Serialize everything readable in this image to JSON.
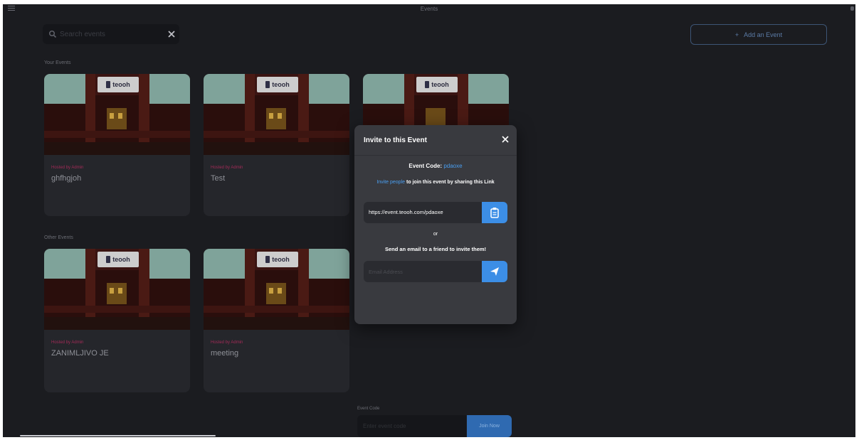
{
  "header": {
    "title": "Events"
  },
  "search": {
    "placeholder": "Search events"
  },
  "add_event": {
    "label": "Add an Event",
    "icon": "plus-icon"
  },
  "sections": {
    "your_events": "Your Events",
    "other_events": "Other Events"
  },
  "logo_text": "teooh",
  "your_events": [
    {
      "host": "Hosted by Admin",
      "title": "ghfhgjoh"
    },
    {
      "host": "Hosted by Admin",
      "title": "Test"
    },
    {
      "host": "",
      "title": ""
    }
  ],
  "other_events": [
    {
      "host": "Hosted by Admin",
      "title": "ZANIMLJIVO JE"
    },
    {
      "host": "Hosted by Admin",
      "title": "meeting"
    }
  ],
  "invite_modal": {
    "title": "Invite to this Event",
    "event_code_label": "Event Code:",
    "event_code": "pdaoxe",
    "invite_link_text": "Invite people",
    "invite_rest_text": "to join this event by sharing this Link",
    "url": "https://event.teooh.com/pdaoxe",
    "or_text": "or",
    "email_prompt": "Send an email to a friend to invite them!",
    "email_placeholder": "Email Address"
  },
  "join": {
    "label": "Event Code",
    "placeholder": "Enter event code",
    "button": "Join Now"
  },
  "colors": {
    "background": "#1b1c20",
    "card": "#25262b",
    "modal": "#393a3f",
    "accent": "#3c8ee6",
    "host_text": "#a22b57"
  }
}
